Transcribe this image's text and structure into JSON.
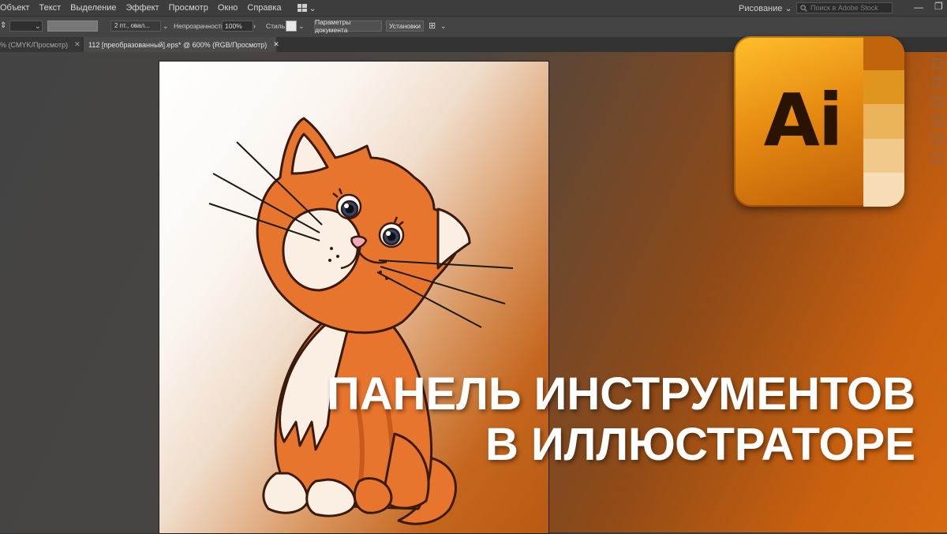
{
  "menubar": {
    "items": [
      "Объект",
      "Текст",
      "Выделение",
      "Эффект",
      "Просмотр",
      "Окно",
      "Справка"
    ],
    "workspace": "Рисование",
    "search_placeholder": "Поиск в Adobe Stock"
  },
  "controlbar": {
    "stroke_profile": "2 пт., овал...",
    "opacity_label": "Непрозрачность:",
    "opacity_value": "100%",
    "style_label": "Стиль:",
    "doc_settings_button": "Параметры документа",
    "preferences_button": "Установки"
  },
  "tabs": [
    {
      "label": "% (CMYK/Просмотр)",
      "active": false
    },
    {
      "label": "112 [преобразованный].eps* @ 600% (RGB/Просмотр)",
      "active": true
    }
  ],
  "logo": {
    "text": "Ai",
    "stripe_colors": [
      "#c0650c",
      "#e0951e",
      "#eab35a",
      "#f0c98a",
      "#f6ddb5"
    ]
  },
  "headline": {
    "line1": "ПАНЕЛЬ ИНСТРУМЕНТОВ",
    "line2": "В ИЛЛЮСТРАТОРЕ"
  },
  "colors": {
    "accent": "#d46a10",
    "cat_orange": "#e8752e",
    "cat_outline": "#3a1a0a"
  }
}
